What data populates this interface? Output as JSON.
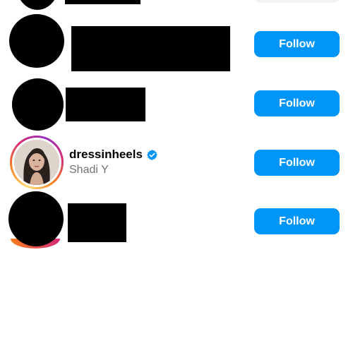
{
  "rows": [
    {
      "follow_label": "Follow"
    },
    {
      "follow_label": "Follow"
    },
    {
      "username": "dressinheels",
      "full_name": "Shadi Y",
      "follow_label": "Follow",
      "verified": true
    },
    {
      "follow_label": "Follow"
    }
  ],
  "colors": {
    "follow_button": "#0095f6",
    "verified_badge": "#0095f6",
    "secondary_text": "#737373",
    "story_ring": [
      "#feda75",
      "#fa7e1e",
      "#d62976",
      "#962fbf"
    ]
  },
  "icons": {
    "verified": "verified-badge-icon"
  }
}
